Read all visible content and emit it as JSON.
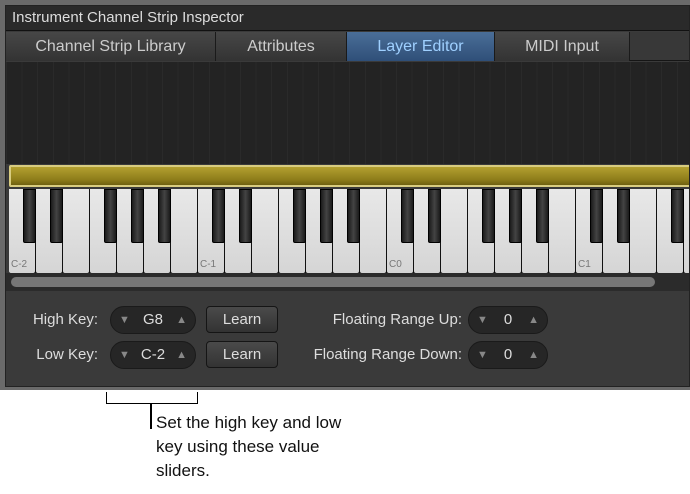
{
  "window": {
    "title": "Instrument Channel Strip Inspector"
  },
  "tabs": [
    {
      "label": "Channel Strip Library",
      "active": false
    },
    {
      "label": "Attributes",
      "active": false
    },
    {
      "label": "Layer Editor",
      "active": true
    },
    {
      "label": "MIDI Input",
      "active": false
    }
  ],
  "keyboard": {
    "octave_labels": [
      "C-2",
      "C-1",
      "C0",
      "C1"
    ],
    "range_color": "#a08f25"
  },
  "controls": {
    "high_key": {
      "label": "High Key:",
      "value": "G8",
      "learn": "Learn"
    },
    "low_key": {
      "label": "Low Key:",
      "value": "C-2",
      "learn": "Learn"
    },
    "float_up": {
      "label": "Floating Range Up:",
      "value": "0"
    },
    "float_down": {
      "label": "Floating Range Down:",
      "value": "0"
    },
    "down_arrow": "▼",
    "up_arrow": "▲"
  },
  "callout": {
    "text": "Set the high key and low key using these value sliders."
  }
}
